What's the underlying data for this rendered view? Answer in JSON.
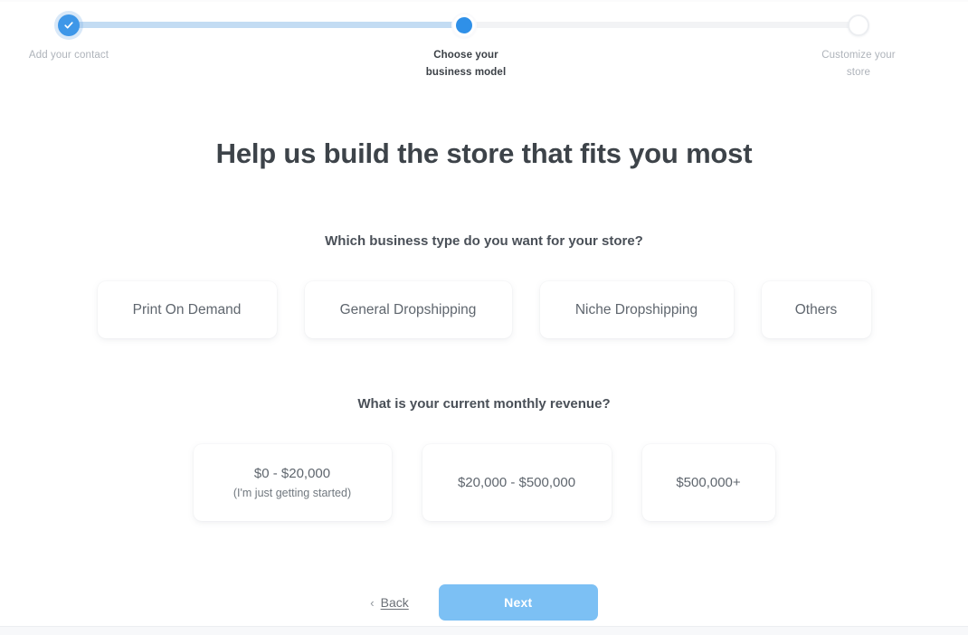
{
  "stepper": {
    "steps": [
      {
        "label": "Add your contact",
        "state": "completed",
        "icon": "check-icon"
      },
      {
        "label": "Choose your\nbusiness model",
        "label_line1": "Choose your",
        "label_line2": "business model",
        "state": "current"
      },
      {
        "label": "Customize your\nstore",
        "label_line1": "Customize your",
        "label_line2": "store",
        "state": "upcoming"
      }
    ],
    "track_done_color": "#c3dcf3",
    "track_todo_color": "#f2f3f5",
    "active_color": "#2f90e8"
  },
  "headline": "Help us build the store that fits you most",
  "questions": [
    {
      "prompt": "Which business type do you want for your store?",
      "options": [
        {
          "title": "Print On Demand"
        },
        {
          "title": "General Dropshipping"
        },
        {
          "title": "Niche Dropshipping"
        },
        {
          "title": "Others"
        }
      ]
    },
    {
      "prompt": "What is your current monthly revenue?",
      "options": [
        {
          "title": "$0 - $20,000",
          "subtitle": "(I'm just getting started)"
        },
        {
          "title": "$20,000 - $500,000",
          "subtitle": ""
        },
        {
          "title": "$500,000+",
          "subtitle": ""
        }
      ]
    }
  ],
  "footer": {
    "back_chevron": "‹",
    "back_label": "Back",
    "next_label": "Next",
    "next_color": "#7cc0f4"
  }
}
